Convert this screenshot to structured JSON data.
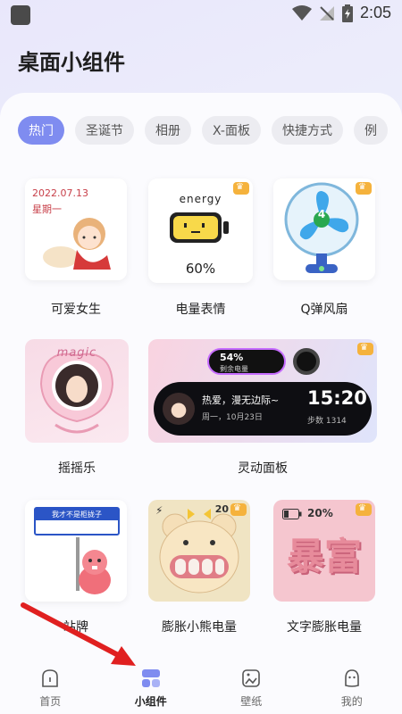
{
  "status": {
    "time": "2:05"
  },
  "title": "桌面小组件",
  "tabs": [
    "热门",
    "圣诞节",
    "相册",
    "X-面板",
    "快捷方式",
    "例"
  ],
  "widgets": [
    {
      "name": "可爱女生",
      "date": "2022.07.13",
      "weekday": "星期一"
    },
    {
      "name": "电量表情",
      "word": "energy",
      "percent": "60%",
      "premium": true
    },
    {
      "name": "Q弹风扇",
      "number": "4",
      "premium": true
    },
    {
      "name": "摇摇乐",
      "word": "magic"
    },
    {
      "name": "灵动面板",
      "battery_pct": "54%",
      "battery_label": "剩余电量",
      "quote": "热爱，漫无边际~",
      "date_line": "周一，10月23日",
      "time": "15:20",
      "steps": "步数 1314",
      "premium": true
    },
    {
      "name": "站牌",
      "sign_text": "我才不是柜拢子",
      "premium": false
    },
    {
      "name": "膨胀小熊电量",
      "percent": "20",
      "premium": true
    },
    {
      "name": "文字膨胀电量",
      "percent": "20%",
      "big_text": "暴富",
      "premium": true
    }
  ],
  "nav": [
    {
      "label": "首页",
      "icon": "home-icon"
    },
    {
      "label": "小组件",
      "icon": "widgets-icon"
    },
    {
      "label": "壁纸",
      "icon": "wallpaper-icon"
    },
    {
      "label": "我的",
      "icon": "profile-icon"
    }
  ],
  "colors": {
    "accent": "#7f8cf0",
    "premium": "#f5b23c",
    "annotation": "#e02020"
  }
}
